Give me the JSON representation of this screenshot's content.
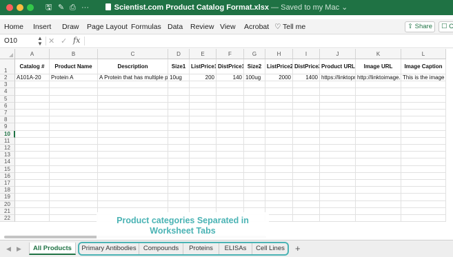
{
  "window": {
    "filename": "Scientist.com Product Catalog Format.xlsx",
    "saved_status": "— Saved to my Mac ⌄",
    "more_icon": "···"
  },
  "menu": {
    "items": [
      "Home",
      "Insert",
      "Draw",
      "Page Layout",
      "Formulas",
      "Data",
      "Review",
      "View",
      "Acrobat",
      "Tell me"
    ],
    "share_label": "Share",
    "comments_label": "C"
  },
  "formula_bar": {
    "name_box": "O10",
    "fx": "fx",
    "content": ""
  },
  "grid": {
    "columns": [
      "A",
      "B",
      "C",
      "D",
      "E",
      "F",
      "G",
      "H",
      "I",
      "J",
      "K",
      "L"
    ],
    "header_row": [
      "Catalog #",
      "Product Name",
      "Description",
      "Size1",
      "ListPrice1",
      "DistPrice1",
      "Size2",
      "ListPrice2",
      "DistPrice2",
      "Product URL",
      "Image URL",
      "Image Caption"
    ],
    "data_row": [
      "A101A-20",
      "Protein A",
      "A Protein that has multiple pro",
      "10ug",
      "200",
      "140",
      "100ug",
      "2000",
      "1400",
      "https://linktopr",
      "http://linktoimage.",
      "This is the image"
    ],
    "row_numbers": [
      "1",
      "2",
      "3",
      "4",
      "5",
      "6",
      "7",
      "8",
      "9",
      "10",
      "11",
      "12",
      "13",
      "14",
      "15",
      "16",
      "17",
      "18",
      "19",
      "20",
      "21",
      "22"
    ],
    "active_row": "10"
  },
  "annotation": {
    "line1": "Product categories Separated in",
    "line2": "Worksheet Tabs",
    "color": "#4ab3b4"
  },
  "sheets": {
    "active": "All Products",
    "tabs": [
      "All Products",
      "Primary Antibodies",
      "Compounds",
      "Proteins",
      "ELISAs",
      "Cell Lines"
    ],
    "add": "+"
  },
  "colors": {
    "excel_green": "#1f7244"
  }
}
